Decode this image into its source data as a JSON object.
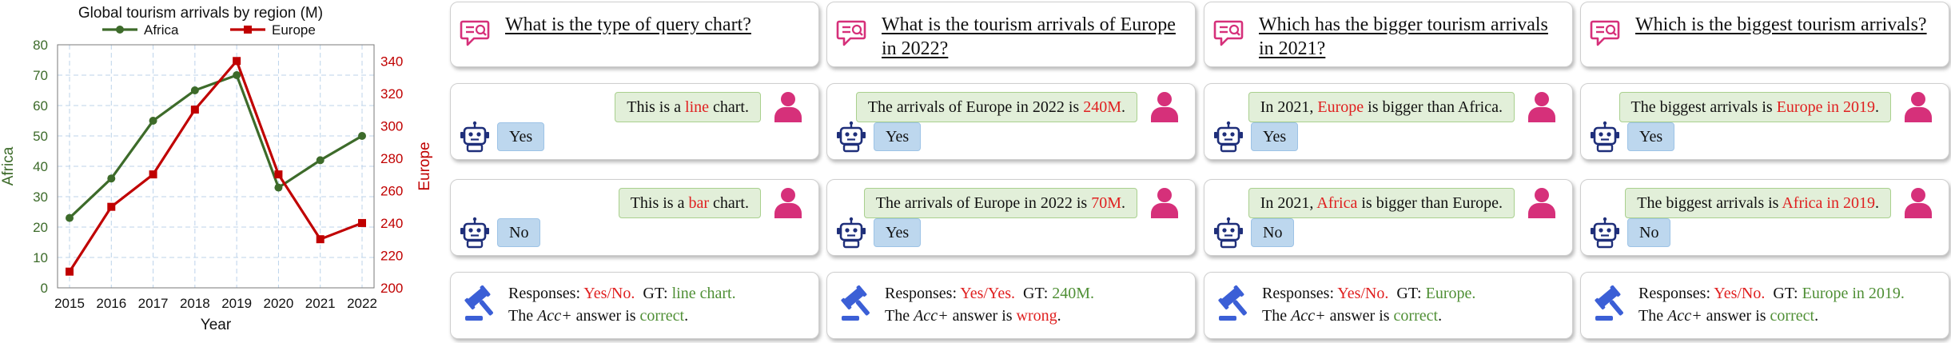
{
  "chart_data": {
    "type": "line",
    "title": "Global tourism arrivals by region (M)",
    "xlabel": "Year",
    "x": [
      "2015",
      "2016",
      "2017",
      "2018",
      "2019",
      "2020",
      "2021",
      "2022"
    ],
    "y_left": {
      "label": "Africa",
      "range": [
        0,
        80
      ],
      "ticks": [
        0,
        10,
        20,
        30,
        40,
        50,
        60,
        70,
        80
      ]
    },
    "y_right": {
      "label": "Europe",
      "range": [
        200,
        350
      ],
      "ticks": [
        200,
        220,
        240,
        260,
        280,
        300,
        320,
        340
      ]
    },
    "grid": true,
    "legend_position": "top",
    "series": [
      {
        "name": "Africa",
        "axis": "left",
        "color": "#3d6b2a",
        "marker": "circle",
        "values": [
          23,
          36,
          55,
          65,
          70,
          33,
          42,
          50
        ]
      },
      {
        "name": "Europe",
        "axis": "right",
        "color": "#c00000",
        "marker": "square",
        "values": [
          210,
          250,
          270,
          310,
          340,
          270,
          230,
          240
        ]
      }
    ]
  },
  "columns": [
    {
      "question": "What is the type of query chart?",
      "convos": [
        {
          "user_pre": "This is a ",
          "user_key": "line",
          "user_post": " chart.",
          "bot": "Yes"
        },
        {
          "user_pre": "This is a ",
          "user_key": "bar",
          "user_post": " chart.",
          "bot": "No"
        }
      ],
      "result": {
        "responses_label": "Responses:",
        "responses": "Yes/No.",
        "gt_label": "GT:",
        "gt": "line chart.",
        "verdict_pre": "The ",
        "metric": "Acc+",
        "verdict_mid": " answer is ",
        "verdict": "correct",
        "verdict_end": "."
      }
    },
    {
      "question": "What is the tourism arrivals of Europe in 2022?",
      "convos": [
        {
          "user_pre": "The arrivals of Europe in 2022 is ",
          "user_key": "240M",
          "user_post": ".",
          "bot": "Yes"
        },
        {
          "user_pre": "The arrivals of Europe in 2022 is ",
          "user_key": "70M",
          "user_post": ".",
          "bot": "Yes"
        }
      ],
      "result": {
        "responses_label": "Responses:",
        "responses": "Yes/Yes.",
        "gt_label": "GT:",
        "gt": "240M.",
        "verdict_pre": "The ",
        "metric": "Acc+",
        "verdict_mid": " answer is ",
        "verdict": "wrong",
        "verdict_end": "."
      }
    },
    {
      "question": "Which has the bigger tourism arrivals in 2021?",
      "convos": [
        {
          "user_pre": "In 2021, ",
          "user_key": "Europe",
          "user_post": " is bigger than Africa.",
          "bot": "Yes"
        },
        {
          "user_pre": "In 2021, ",
          "user_key": "Africa",
          "user_post": " is bigger than Europe.",
          "bot": "No"
        }
      ],
      "result": {
        "responses_label": "Responses:",
        "responses": "Yes/No.",
        "gt_label": "GT:",
        "gt": "Europe.",
        "verdict_pre": "The ",
        "metric": "Acc+",
        "verdict_mid": " answer is ",
        "verdict": "correct",
        "verdict_end": "."
      }
    },
    {
      "question": "Which is the biggest tourism arrivals?",
      "convos": [
        {
          "user_pre": "The biggest arrivals is ",
          "user_key": "Europe in 2019",
          "user_post": ".",
          "bot": "Yes"
        },
        {
          "user_pre": "The biggest arrivals is ",
          "user_key": "Africa in 2019",
          "user_post": ".",
          "bot": "No"
        }
      ],
      "result": {
        "responses_label": "Responses:",
        "responses": "Yes/No.",
        "gt_label": "GT:",
        "gt": "Europe in 2019.",
        "verdict_pre": "The ",
        "metric": "Acc+",
        "verdict_mid": " answer is ",
        "verdict": "correct",
        "verdict_end": "."
      }
    }
  ],
  "colors": {
    "icon_pink": "#d6307a",
    "icon_navy": "#1f2f7a",
    "gavel_blue": "#3b5fd6",
    "correct": "#4f8f35",
    "wrong": "#e02020",
    "key_red": "#e02020"
  },
  "icons": {
    "question": "chat-question-icon",
    "user": "user-icon",
    "bot": "robot-icon",
    "judge": "gavel-icon"
  }
}
